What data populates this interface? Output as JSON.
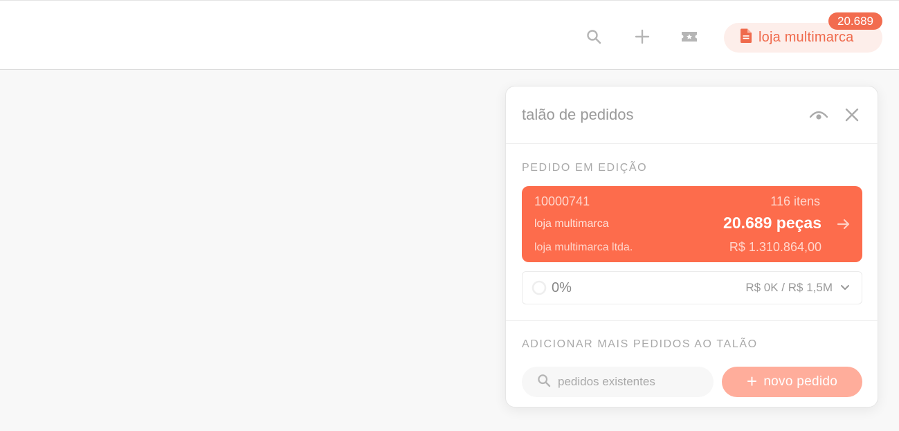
{
  "topbar": {
    "store_label": "loja multimarca",
    "cart_count": "20.689",
    "icons": [
      "search-icon",
      "plus-icon",
      "ticket-icon",
      "document-icon"
    ]
  },
  "panel": {
    "title": "talão de pedidos",
    "icons": [
      "eye-icon",
      "close-icon"
    ],
    "editing_label": "PEDIDO EM EDIÇÃO",
    "order": {
      "number": "10000741",
      "items": "116 itens",
      "store": "loja multimarca",
      "pieces": "20.689 peças",
      "company": "loja multimarca ltda.",
      "value": "R$ 1.310.864,00"
    },
    "progress": {
      "percent_label": "0%",
      "fraction": 0,
      "budget": "R$ 0K / R$ 1,5M"
    },
    "add_label": "ADICIONAR MAIS PEDIDOS AO TALÃO",
    "search_placeholder": "pedidos existentes",
    "new_order_label": "novo pedido"
  },
  "colors": {
    "accent": "#fd6c4c",
    "accent_light": "#ffad9b",
    "pill_bg": "#fdeeea"
  }
}
